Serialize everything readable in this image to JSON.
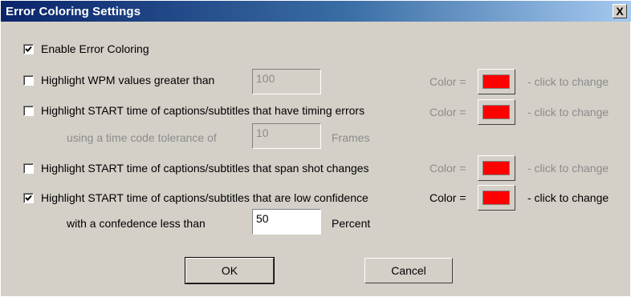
{
  "window": {
    "title": "Error Coloring Settings",
    "close_label": "X"
  },
  "enable": {
    "label": "Enable Error Coloring",
    "checked": true
  },
  "wpm": {
    "label": "Highlight WPM values greater than",
    "value": "100",
    "checked": false,
    "color_label": "Color =",
    "hint": "- click to change",
    "color": "#ff0000"
  },
  "timing": {
    "label": "Highlight START time of captions/subtitles that have timing errors",
    "checked": false,
    "color_label": "Color =",
    "hint": "- click to change",
    "color": "#ff0000",
    "tolerance_label": "using a time code tolerance of",
    "tolerance_value": "10",
    "tolerance_unit": "Frames"
  },
  "shot": {
    "label": "Highlight START time of captions/subtitles that span shot changes",
    "checked": false,
    "color_label": "Color =",
    "hint": "- click to change",
    "color": "#ff0000"
  },
  "confidence": {
    "label": "Highlight START time of captions/subtitles that are low confidence",
    "checked": true,
    "color_label": "Color =",
    "hint": "- click to change",
    "color": "#ff0000",
    "threshold_label": "with a confedence less than",
    "threshold_value": "50",
    "threshold_unit": "Percent"
  },
  "buttons": {
    "ok": "OK",
    "cancel": "Cancel"
  }
}
